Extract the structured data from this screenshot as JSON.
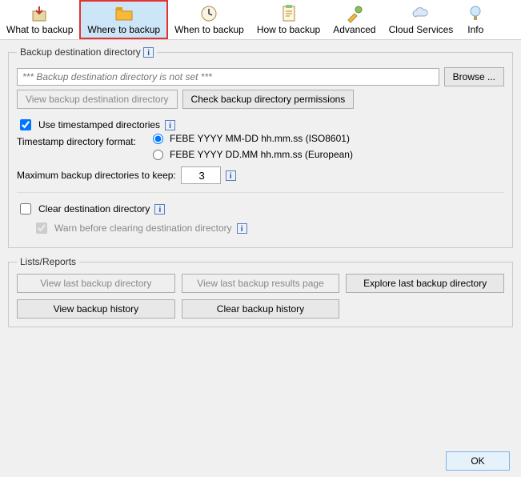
{
  "tabs": [
    {
      "label": "What to backup"
    },
    {
      "label": "Where to backup"
    },
    {
      "label": "When to backup"
    },
    {
      "label": "How to backup"
    },
    {
      "label": "Advanced"
    },
    {
      "label": "Cloud Services"
    },
    {
      "label": "Info"
    }
  ],
  "dest": {
    "legend": "Backup destination directory",
    "path_placeholder": "*** Backup destination directory is not set ***",
    "browse": "Browse ...",
    "view_dir": "View backup destination directory",
    "check_perm": "Check backup directory permissions",
    "use_ts": "Use timestamped directories",
    "ts_fmt_label": "Timestamp directory format:",
    "fmt_iso": "FEBE YYYY MM-DD hh.mm.ss (ISO8601)",
    "fmt_eu": "FEBE YYYY DD.MM hh.mm.ss (European)",
    "max_label": "Maximum backup directories to keep:",
    "max_value": "3",
    "clear": "Clear destination directory",
    "warn": "Warn before clearing destination directory"
  },
  "lists": {
    "legend": "Lists/Reports",
    "view_last_dir": "View last backup directory",
    "view_last_results": "View last backup results page",
    "explore_last_dir": "Explore last backup directory",
    "view_history": "View backup history",
    "clear_history": "Clear backup history"
  },
  "footer": {
    "ok": "OK"
  }
}
